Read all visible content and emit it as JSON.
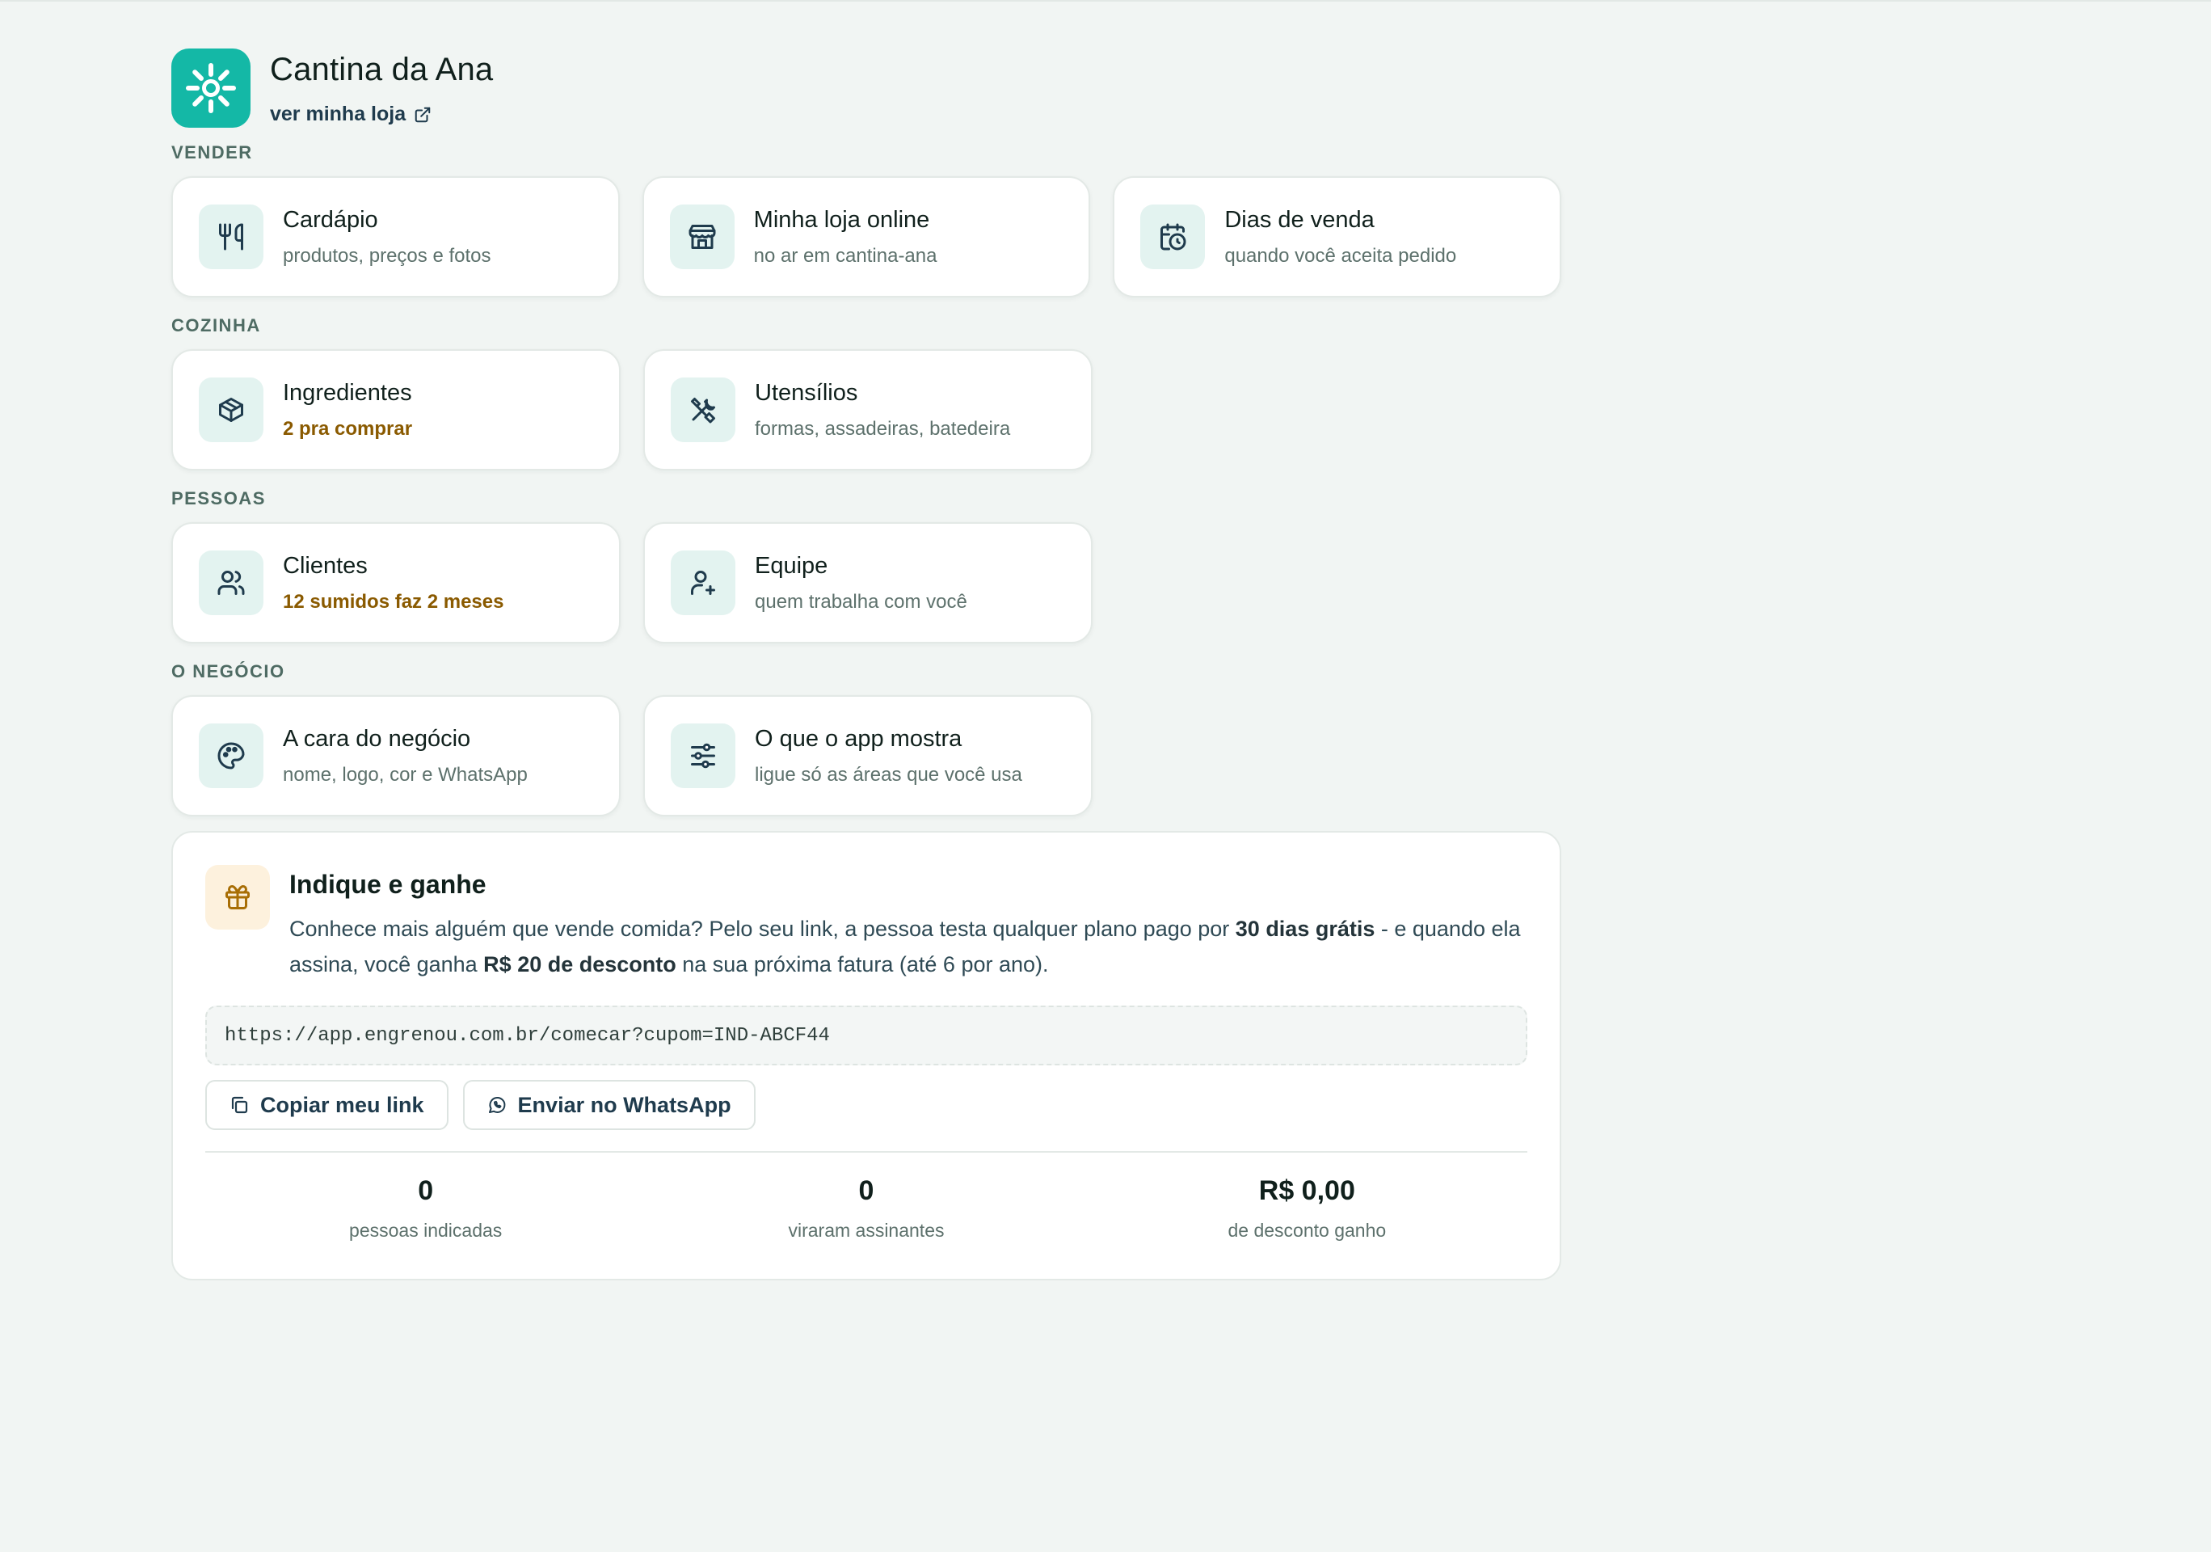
{
  "store": {
    "name": "Cantina da Ana",
    "view_link": "ver minha loja"
  },
  "sections": [
    {
      "title": "VENDER",
      "cards": [
        {
          "title": "Cardápio",
          "subtitle": "produtos, preços e fotos",
          "icon": "utensils-icon"
        },
        {
          "title": "Minha loja online",
          "subtitle": "no ar em cantina-ana",
          "icon": "store-icon"
        },
        {
          "title": "Dias de venda",
          "subtitle": "quando você aceita pedido",
          "icon": "calendar-clock-icon"
        }
      ]
    },
    {
      "title": "COZINHA",
      "cards": [
        {
          "title": "Ingredientes",
          "subtitle": "2 pra comprar",
          "icon": "package-icon",
          "subtitle_warn": true
        },
        {
          "title": "Utensílios",
          "subtitle": "formas, assadeiras, batedeira",
          "icon": "tools-icon"
        }
      ]
    },
    {
      "title": "PESSOAS",
      "cards": [
        {
          "title": "Clientes",
          "subtitle": "12 sumidos faz 2 meses",
          "icon": "users-icon",
          "subtitle_warn": true
        },
        {
          "title": "Equipe",
          "subtitle": "quem trabalha com você",
          "icon": "user-plus-icon"
        }
      ]
    },
    {
      "title": "O NEGÓCIO",
      "cards": [
        {
          "title": "A cara do negócio",
          "subtitle": "nome, logo, cor e WhatsApp",
          "icon": "palette-icon"
        },
        {
          "title": "O que o app mostra",
          "subtitle": "ligue só as áreas que você usa",
          "icon": "sliders-icon"
        }
      ]
    }
  ],
  "referral": {
    "title": "Indique e ganhe",
    "desc_part1": "Conhece mais alguém que vende comida? Pelo seu link, a pessoa testa qualquer plano pago por ",
    "desc_bold1": "30 dias grátis",
    "desc_part2": " - e quando ela assina, você ganha ",
    "desc_bold2": "R$ 20 de desconto",
    "desc_part3": " na sua próxima fatura (até 6 por ano).",
    "link": "https://app.engrenou.com.br/comecar?cupom=IND-ABCF44",
    "copy_button": "Copiar meu link",
    "whatsapp_button": "Enviar no WhatsApp",
    "stats": [
      {
        "value": "0",
        "label": "pessoas indicadas"
      },
      {
        "value": "0",
        "label": "viraram assinantes"
      },
      {
        "value": "R$ 0,00",
        "label": "de desconto ganho"
      }
    ]
  },
  "colors": {
    "accent": "#14b8a6",
    "icon_bg": "#e3f3f0",
    "warning_text": "#8a5a00",
    "gift_bg": "#fdf1dd",
    "page_bg": "#f1f5f3"
  }
}
